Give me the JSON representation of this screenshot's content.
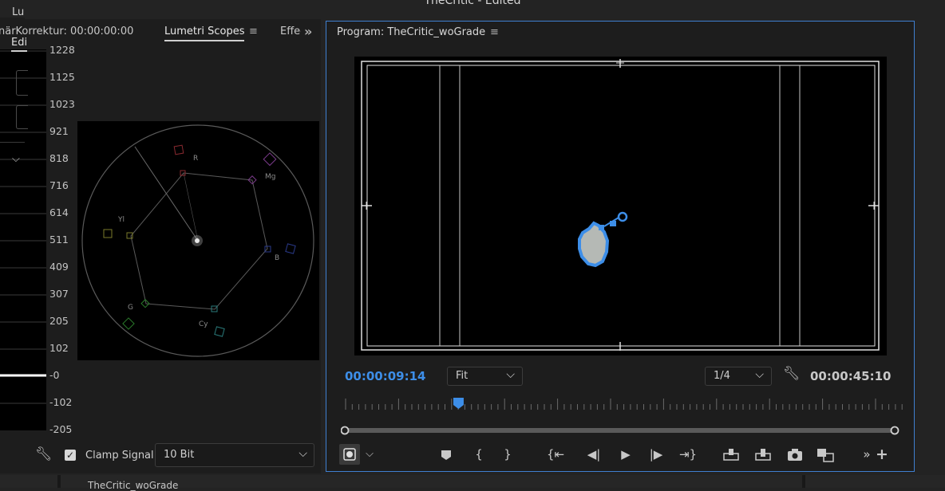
{
  "app": {
    "title": "TheCritic - Edited"
  },
  "left_panel": {
    "tab_primaer": "närKorrektur: 00:00:00:00",
    "tab_lumetri": "Lumetri Scopes",
    "tab_effects": "Effec",
    "overflow": "»",
    "scale": [
      "1228",
      "1125",
      "1023",
      "921",
      "818",
      "716",
      "614",
      "511",
      "409",
      "307",
      "205",
      "102",
      "-0",
      "-102",
      "-205"
    ],
    "vectorscope_labels": {
      "r": "R",
      "mg": "Mg",
      "yl": "Yl",
      "b": "B",
      "g": "G",
      "cy": "Cy"
    },
    "clamp_label": "Clamp Signal",
    "bit_depth": "10 Bit"
  },
  "program": {
    "title": "Program: TheCritic_woGrade",
    "current_time": "00:00:09:14",
    "duration": "00:00:45:10",
    "zoom": "Fit",
    "resolution": "1/4",
    "playhead_fraction": 0.205
  },
  "right_panel": {
    "tab": "Lu",
    "subtab": "Edi"
  },
  "bottom": {
    "tab": "TheCritic_woGrade"
  }
}
